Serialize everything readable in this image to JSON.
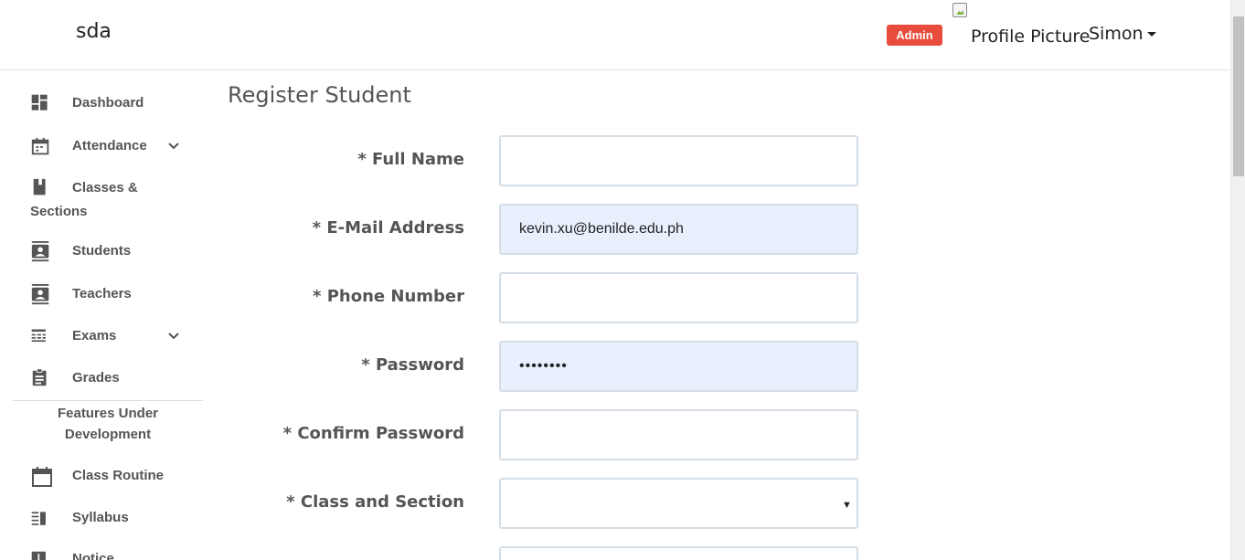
{
  "header": {
    "brand": "sda",
    "role_badge": "Admin",
    "avatar_alt": "Profile Picture",
    "user_name": "Simon"
  },
  "sidebar": {
    "items": [
      {
        "label": "Dashboard",
        "icon": "dashboard-icon"
      },
      {
        "label": "Attendance",
        "icon": "calendar-icon",
        "expandable": true
      },
      {
        "label": "Classes &",
        "label2": "Sections",
        "icon": "book-icon"
      },
      {
        "label": "Students",
        "icon": "contact-card-icon"
      },
      {
        "label": "Teachers",
        "icon": "contact-card-icon"
      },
      {
        "label": "Exams",
        "icon": "exam-list-icon",
        "expandable": true
      },
      {
        "label": "Grades",
        "icon": "clipboard-icon"
      },
      {
        "label": "Class Routine",
        "icon": "calendar-blank-icon"
      },
      {
        "label": "Syllabus",
        "icon": "syllabus-icon"
      },
      {
        "label": "Notice",
        "icon": "notice-icon"
      }
    ],
    "section_heading": "Features Under Development"
  },
  "main": {
    "title": "Register Student",
    "fields": [
      {
        "label": "* Full Name",
        "value": "",
        "type": "text"
      },
      {
        "label": "* E-Mail Address",
        "value": "kevin.xu@benilde.edu.ph",
        "type": "email"
      },
      {
        "label": "* Phone Number",
        "value": "",
        "type": "text"
      },
      {
        "label": "* Password",
        "value": "••••••••",
        "type": "password"
      },
      {
        "label": "* Confirm Password",
        "value": "",
        "type": "password"
      },
      {
        "label": "* Class and Section",
        "value": "",
        "type": "select"
      }
    ]
  },
  "colors": {
    "badge": "#e74c3c",
    "autofill": "#e8f0fe",
    "input_border": "#d5dde5",
    "text_muted": "#555555"
  }
}
